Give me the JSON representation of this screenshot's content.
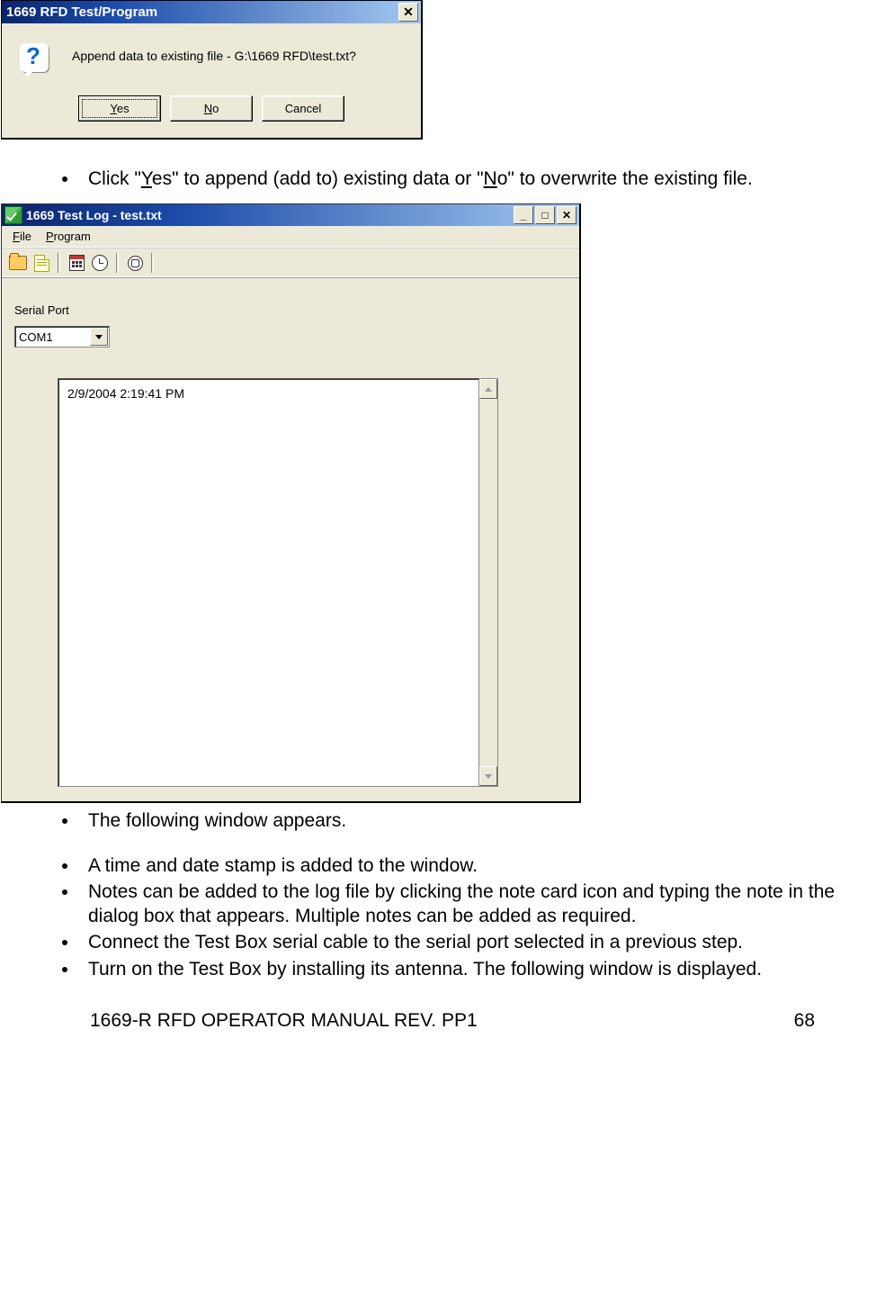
{
  "dialog1": {
    "title": "1669 RFD Test/Program",
    "message": "Append data to existing file - G:\\1669 RFD\\test.txt?",
    "yes_pre": "Y",
    "yes_post": "es",
    "no_pre": "N",
    "no_post": "o",
    "cancel": "Cancel"
  },
  "bullet1": {
    "pre": "Click \"",
    "y": "Y",
    "es": "es",
    "mid": "\" to append (add to) existing data or \"",
    "n": "N",
    "o": "o",
    "post": "\" to overwrite the existing file."
  },
  "window2": {
    "title": "1669 Test Log - test.txt",
    "menu_file_u": "F",
    "menu_file": "ile",
    "menu_prog_u": "P",
    "menu_prog": "rogram",
    "serial_label": "Serial Port",
    "serial_value": "COM1",
    "log_entry": "2/9/2004 2:19:41 PM"
  },
  "bullets2": {
    "b1": "The following window appears.",
    "b2": "A time and date stamp is added to the window.",
    "b3": "Notes can be added to the log file by clicking the note card icon and typing the note in the dialog box that appears.  Multiple notes can be added as required.",
    "b4": "Connect the Test Box serial cable to the serial port selected in a previous step.",
    "b5": "Turn on the Test Box by installing its antenna.  The following window is displayed."
  },
  "footer": {
    "left": "1669-R RFD OPERATOR MANUAL REV. PP1",
    "right": "68"
  }
}
